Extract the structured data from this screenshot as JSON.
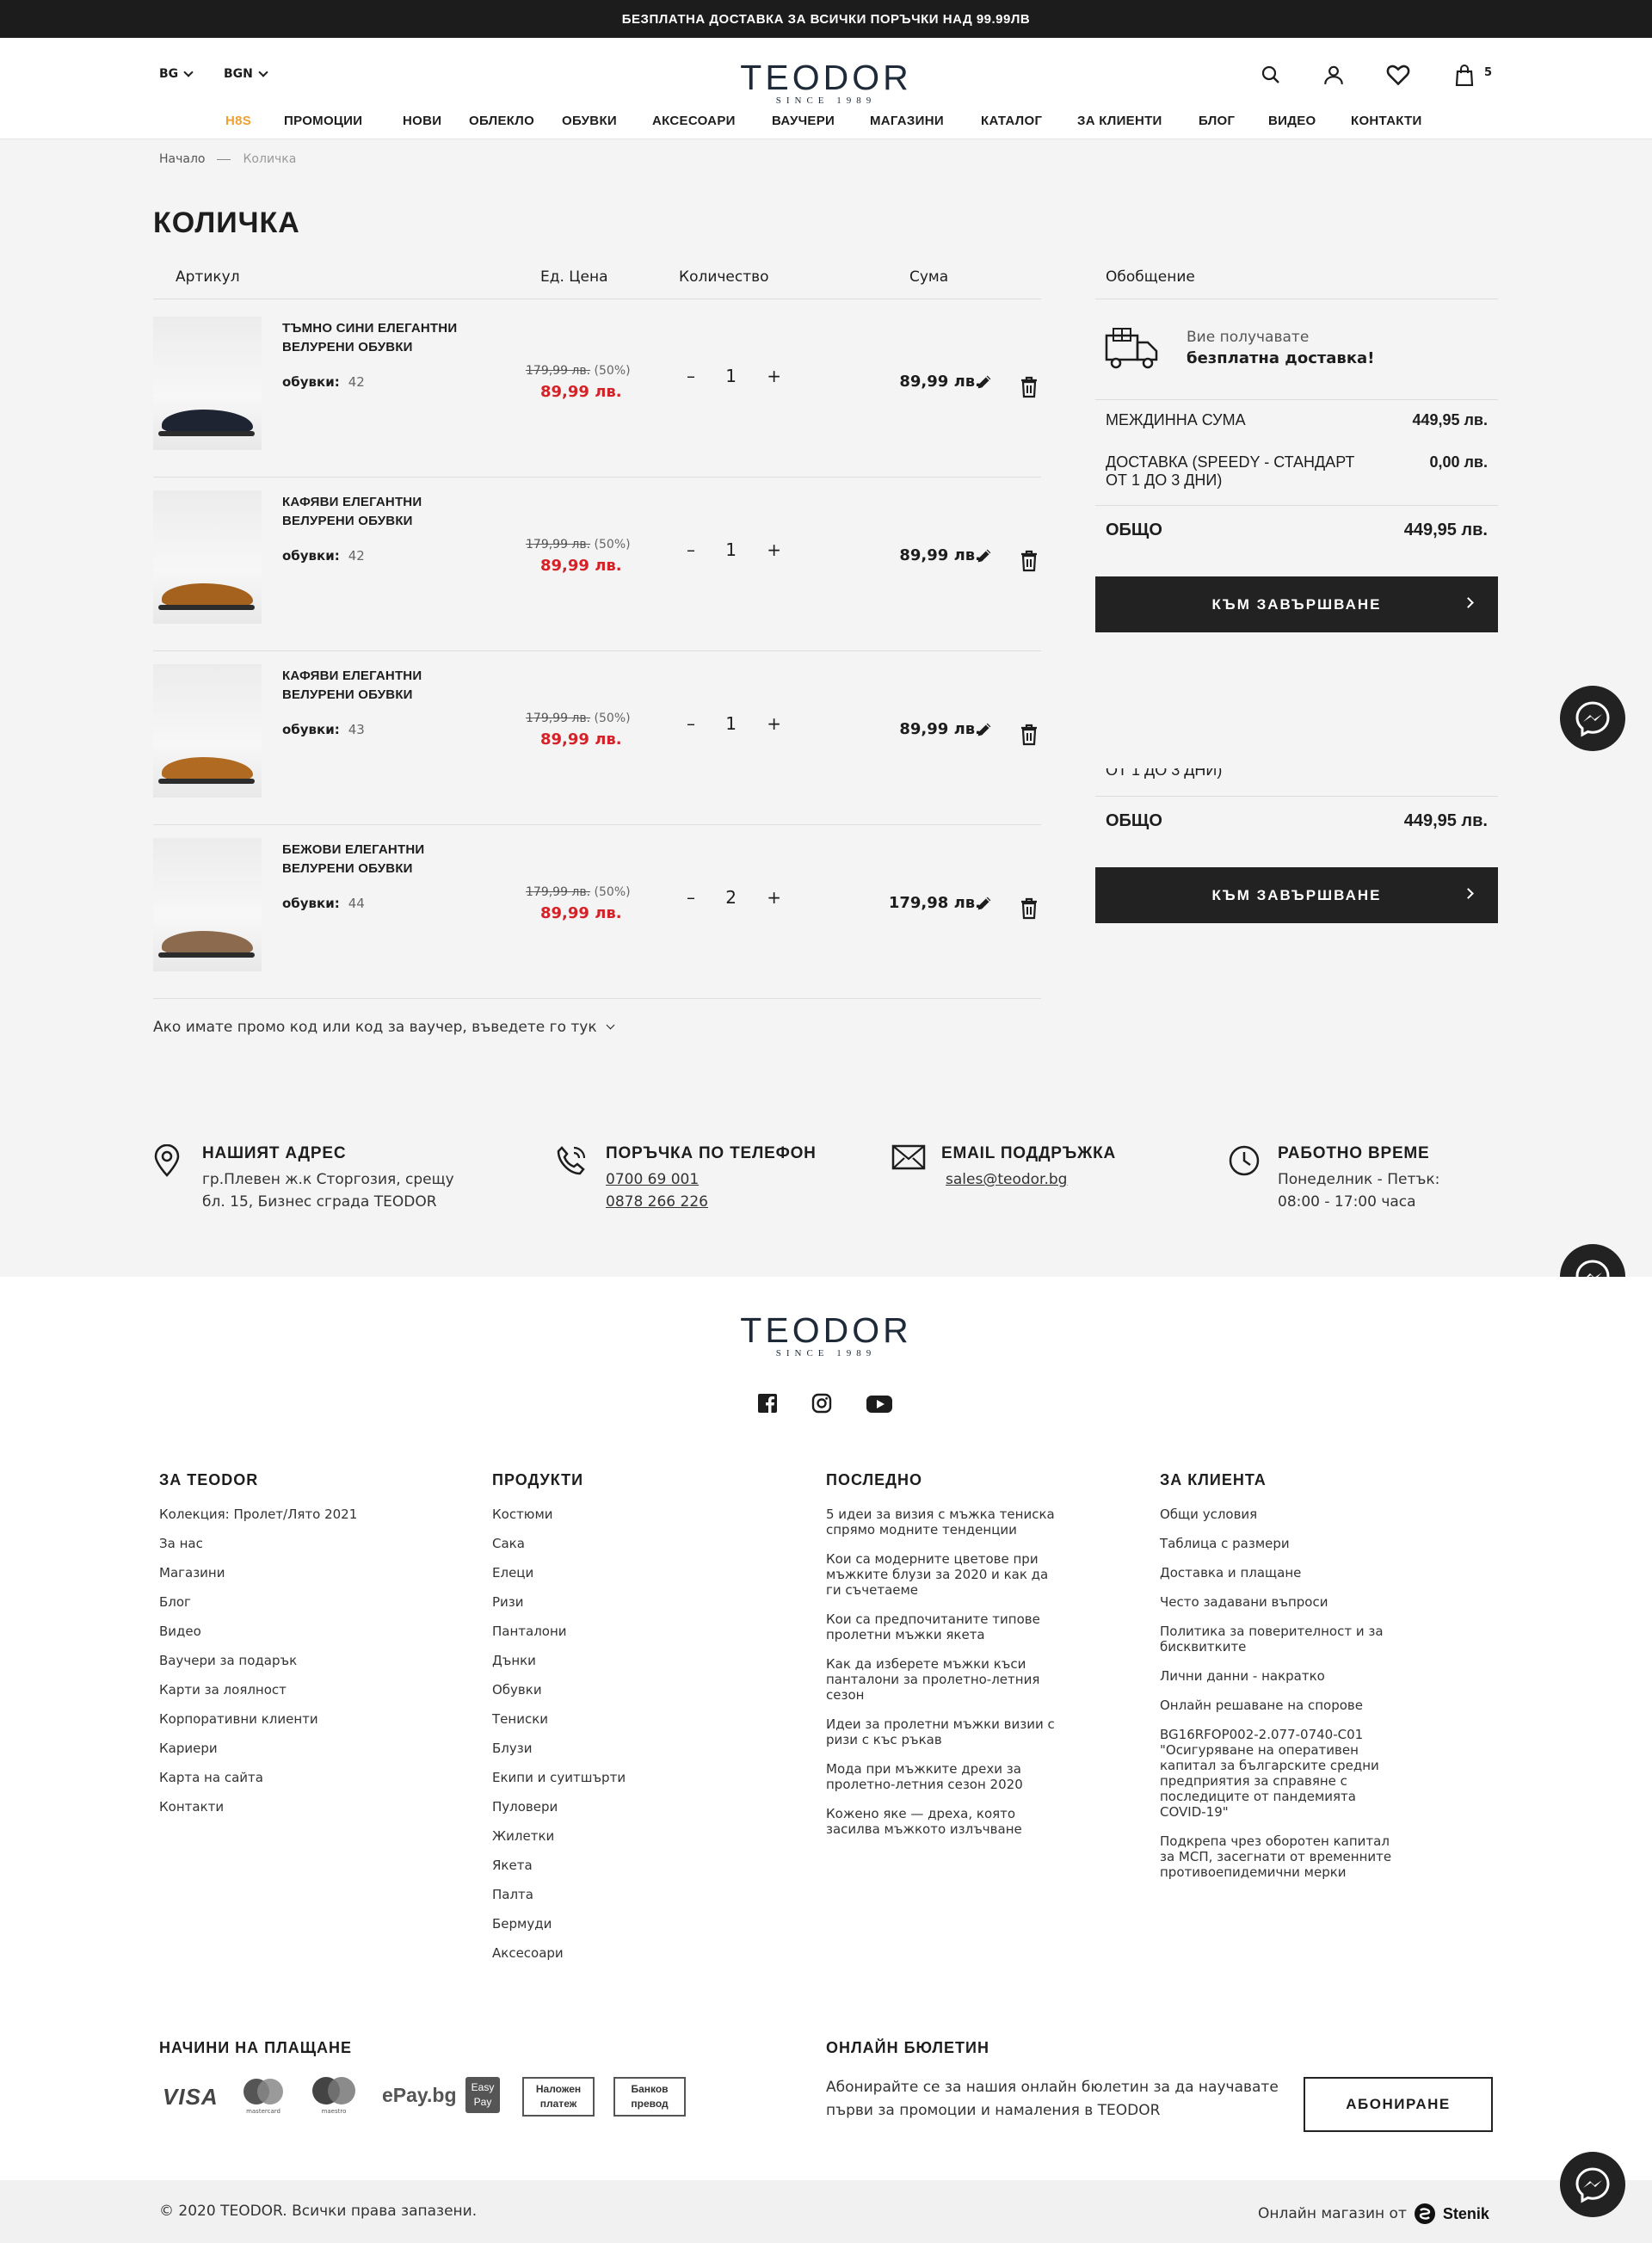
{
  "topbar": {
    "text": "БЕЗПЛАТНА ДОСТАВКА ЗА ВСИЧКИ ПОРЪЧКИ НАД 99.99ЛВ"
  },
  "header": {
    "lang": "BG",
    "currency": "BGN",
    "logo_text": "TEODOR",
    "logo_sub": "SINCE 1989",
    "cart_count": "5",
    "icons": [
      "search-icon",
      "user-icon",
      "heart-icon",
      "shopping-bag-icon"
    ]
  },
  "nav": {
    "items": [
      "H8S",
      "ПРОМОЦИИ",
      "НОВИ",
      "ОБЛЕКЛО",
      "ОБУВКИ",
      "АКСЕСОАРИ",
      "ВАУЧЕРИ",
      "МАГАЗИНИ",
      "КАТАЛОГ",
      "ЗА КЛИЕНТИ",
      "БЛОГ",
      "ВИДЕО",
      "КОНТАКТИ"
    ],
    "accent": "#f0a030"
  },
  "breadcrumb": {
    "home": "Начало",
    "current": "Количка"
  },
  "page_title": "КОЛИЧКА",
  "table": {
    "col_item": "Артикул",
    "col_price": "Ед. Цена",
    "col_qty": "Количество",
    "col_sum": "Сума"
  },
  "items": [
    {
      "name": "ТЪМНО СИНИ ЕЛЕГАНТНИ ВЕЛУРЕНИ ОБУВКИ",
      "size_label": "обувки:",
      "size": "42",
      "old_price": "179,99 лв.",
      "discount": "(50%)",
      "price": "89,99 лв.",
      "qty": "1",
      "sum": "89,99 лв.",
      "shoe_color": "#1f2433"
    },
    {
      "name": "КАФЯВИ ЕЛЕГАНТНИ ВЕЛУРЕНИ ОБУВКИ",
      "size_label": "обувки:",
      "size": "42",
      "old_price": "179,99 лв.",
      "discount": "(50%)",
      "price": "89,99 лв.",
      "qty": "1",
      "sum": "89,99 лв.",
      "shoe_color": "#a5621f"
    },
    {
      "name": "КАФЯВИ ЕЛЕГАНТНИ ВЕЛУРЕНИ ОБУВКИ",
      "size_label": "обувки:",
      "size": "43",
      "old_price": "179,99 лв.",
      "discount": "(50%)",
      "price": "89,99 лв.",
      "qty": "1",
      "sum": "89,99 лв.",
      "shoe_color": "#b16a22"
    },
    {
      "name": "БЕЖОВИ ЕЛЕГАНТНИ ВЕЛУРЕНИ ОБУВКИ",
      "size_label": "обувки:",
      "size": "44",
      "old_price": "179,99 лв.",
      "discount": "(50%)",
      "price": "89,99 лв.",
      "qty": "2",
      "sum": "179,98 лв.",
      "shoe_color": "#8c6a4e"
    }
  ],
  "qty_minus": "–",
  "qty_plus": "+",
  "promo_text": "Ако имате промо код или код за ваучер, въведете го тук",
  "summary": {
    "title": "Обобщение",
    "free_line1": "Вие получавате",
    "free_line2": "безплатна доставка!",
    "subtotal_label": "МЕЖДИННА СУМА",
    "subtotal": "449,95 лв.",
    "delivery_label_1": "ДОСТАВКА (SPEEDY - СТАНДАРТ",
    "delivery_label_2": "ОТ 1 ДО 3 ДНИ)",
    "delivery": "0,00 лв.",
    "total_label": "ОБЩО",
    "total": "449,95 лв.",
    "checkout": "КЪМ ЗАВЪРШВАНЕ",
    "sticky_clip_text": "ОТ 1 ДО 3 ДНИ)"
  },
  "features": [
    {
      "title": "НАШИЯТ АДРЕС",
      "lines": [
        "гр.Плевен ж.к Сторгозия, срещу",
        "бл. 15, Бизнес сграда TEODOR"
      ]
    },
    {
      "title": "ПОРЪЧКА ПО ТЕЛЕФОН",
      "lines": [
        "0700 69 001",
        "0878 266 226"
      ]
    },
    {
      "title": "EMAIL ПОДДРЪЖКА",
      "lines": [
        "sales@teodor.bg"
      ]
    },
    {
      "title": "РАБОТНО ВРЕМЕ",
      "lines": [
        "Понеделник - Петък:",
        "08:00 - 17:00 часа"
      ]
    }
  ],
  "footer": {
    "cols": [
      {
        "title": "ЗА TEODOR",
        "links": [
          "Колекция: Пролет/Лято 2021",
          "За нас",
          "Магазини",
          "Блог",
          "Видео",
          "Ваучери за подарък",
          "Карти за лоялност",
          "Корпоративни клиенти",
          "Кариери",
          "Карта на сайта",
          "Контакти"
        ]
      },
      {
        "title": "ПРОДУКТИ",
        "links": [
          "Костюми",
          "Сака",
          "Елеци",
          "Ризи",
          "Панталони",
          "Дънки",
          "Обувки",
          "Тениски",
          "Блузи",
          "Екипи и суитшърти",
          "Пуловери",
          "Жилетки",
          "Якета",
          "Палта",
          "Бермуди",
          "Аксесоари"
        ]
      },
      {
        "title": "ПОСЛЕДНО",
        "links": [
          "5 идеи за визия с мъжка тениска спрямо модните тенденции",
          "Кои са модерните цветове при мъжките блузи за 2020 и как да ги съчетаеме",
          "Кои са предпочитаните типове пролетни мъжки якета",
          "Как да изберете мъжки къси панталони за пролетно-летния сезон",
          "Идеи за пролетни мъжки визии с ризи с къс ръкав",
          "Мода при мъжките дрехи за пролетно-летния сезон 2020",
          "Кожено яке — дреха, която засилва мъжкото излъчване"
        ]
      },
      {
        "title": "ЗА КЛИЕНТА",
        "links": [
          "Общи условия",
          "Таблица с размери",
          "Доставка и плащане",
          "Често задавани въпроси",
          "Политика за поверителност и за бисквитките",
          "Лични данни - накратко",
          "Онлайн решаване на спорове",
          "BG16RFOP002-2.077-0740-C01 \"Осигуряване на оперативен капитал за българските средни предприятия за справяне с последиците от пандемията COVID-19\"",
          "Подкрепа чрез оборотен капитал за МСП, засегнати от временните противоепидемични мерки"
        ]
      }
    ],
    "pay_title": "НАЧИНИ НА ПЛАЩАНЕ",
    "pay": {
      "visa": "VISA",
      "mc": "mastercard",
      "maestro": "maestro",
      "epay": "ePay.bg",
      "easypay_1": "Easy",
      "easypay_2": "Pay",
      "cod_1": "Наложен",
      "cod_2": "платеж",
      "bank_1": "Банков",
      "bank_2": "превод"
    },
    "newsletter_title": "ОНЛАЙН БЮЛЕТИН",
    "newsletter_text": "Абонирайте се за нашия онлайн бюлетин за да научавате първи за промоции и намаления в TEODOR",
    "subscribe": "АБОНИРАНЕ",
    "copyright": "© 2020 TEODOR. Всички права запазени.",
    "made_by": "Онлайн магазин от",
    "made_by_brand": "Stenik"
  }
}
